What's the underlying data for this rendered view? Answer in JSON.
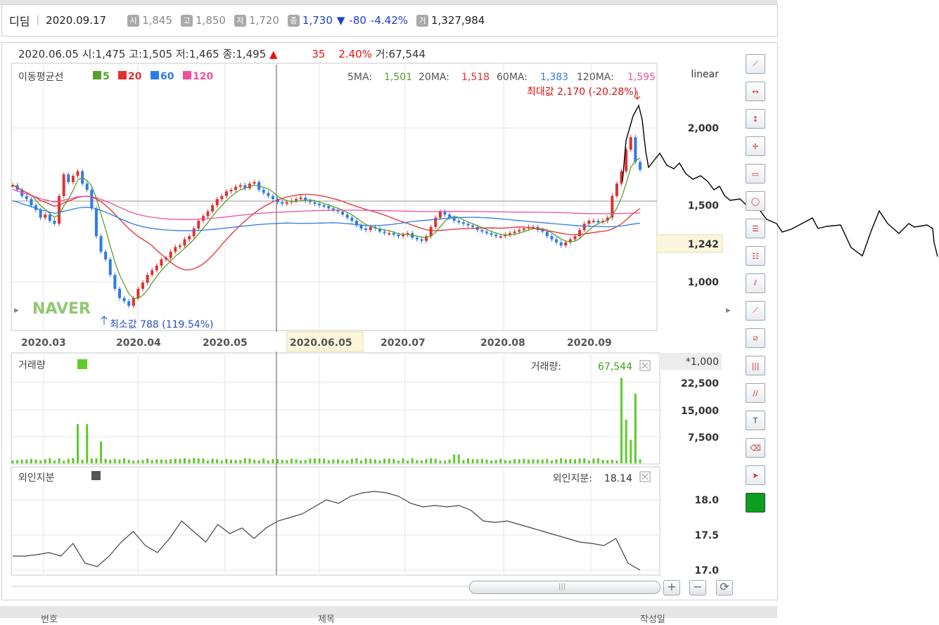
{
  "header": {
    "stock_name": "디딤",
    "date": "2020.09.17",
    "open_badge": "시",
    "open": "1,845",
    "high_badge": "고",
    "high": "1,850",
    "low_badge": "저",
    "low": "1,720",
    "close_badge": "종",
    "close": "1,730",
    "change_arrow": "▼",
    "change": "-80",
    "change_pct": "-4.42%",
    "volume_badge": "거",
    "volume": "1,327,984"
  },
  "info": {
    "date": "2020.06.05",
    "open_label": "시:",
    "open": "1,475",
    "high_label": "고:",
    "high": "1,505",
    "low_label": "저:",
    "low": "1,465",
    "close_label": "종:",
    "close": "1,495",
    "arrow": "▲",
    "change": "35",
    "pct": "2.40%",
    "vol_label": "거:",
    "vol": "67,544"
  },
  "price_panel": {
    "ma_title": "이동평균선",
    "ma_legend": [
      {
        "label": "5",
        "color": "#5aa02c"
      },
      {
        "label": "20",
        "color": "#e03131"
      },
      {
        "label": "60",
        "color": "#2f7be6"
      },
      {
        "label": "120",
        "color": "#f0509c"
      }
    ],
    "ma_values": [
      {
        "label": "5MA:",
        "value": "1,501",
        "color": "#5aa02c"
      },
      {
        "label": "20MA:",
        "value": "1,518",
        "color": "#e03131"
      },
      {
        "label": "60MA:",
        "value": "1,383",
        "color": "#2f7be6"
      },
      {
        "label": "120MA:",
        "value": "1,595",
        "color": "#f0509c"
      }
    ],
    "scale_mode": "linear",
    "y_ticks": [
      "2,000",
      "1,500",
      "1,000"
    ],
    "current_price_tag": "1,242",
    "max_note": "최대값 2,170 (-20.28%)",
    "min_note": "최소값 788 (119.54%)",
    "watermark": "NAVER"
  },
  "x_axis": {
    "labels": [
      "2020.03",
      "2020.04",
      "2020.05",
      "2020.06.05",
      "2020.07",
      "2020.08",
      "2020.09"
    ]
  },
  "volume_panel": {
    "title": "거래량",
    "legend_color": "#5ecb2b",
    "value_label": "거래량:",
    "value": "67,544",
    "unit": "*1,000",
    "y_ticks": [
      "22,500",
      "15,000",
      "7,500"
    ],
    "close_icon": "close-icon"
  },
  "foreign_panel": {
    "title": "외인지분",
    "legend_color": "#555555",
    "value_label": "외인지분:",
    "value": "18.14",
    "y_ticks": [
      "18.0",
      "17.5",
      "17.0"
    ],
    "close_icon": "close-icon"
  },
  "toolbar": [
    "line-tool-icon",
    "horizontal-line-icon",
    "vertical-line-icon",
    "crosshair-icon",
    "rectangle-icon",
    "circle-icon",
    "fibonacci-retracement-icon",
    "fibonacci-time-icon",
    "speed-resistance-icon",
    "fan-lines-icon",
    "gann-icon",
    "parallel-lines-icon",
    "channel-icon",
    "text-tool-icon",
    "eraser-icon",
    "pointer-icon",
    "color-picker-icon"
  ],
  "toolbar_color": "#0aa01f",
  "zoom": {
    "plus": "+",
    "minus": "−",
    "reset": "⟳"
  },
  "bottom_tabs": [
    "번호",
    "제목",
    "작성일"
  ]
}
